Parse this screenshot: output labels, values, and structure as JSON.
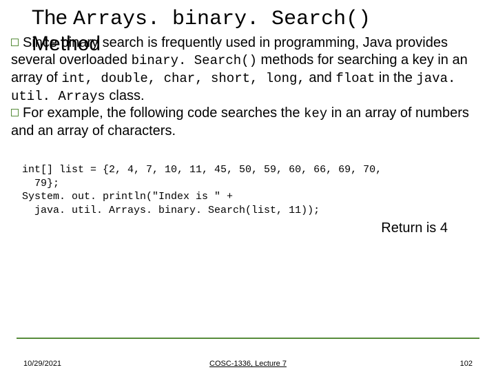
{
  "title": {
    "prefix": "The ",
    "method": "Arrays. binary. Search()",
    "line2": "Method"
  },
  "body": {
    "para1": {
      "lead": "Since binary search is frequently used in programming, Java provides several overloaded ",
      "code1": "binary. Search()",
      "mid1": " methods for searching a key in an array of ",
      "code2": "int, double, char, short, long,",
      "mid2": " and ",
      "code3": "float",
      "mid3": " in the ",
      "code4": "java. util. Arrays",
      "tail": " class."
    },
    "para2": {
      "lead": "For example, the following code searches the ",
      "code1": "key",
      "tail": " in an array of numbers and an array of characters."
    }
  },
  "code": {
    "line1": "int[] list = {2, 4, 7, 10, 11, 45, 50, 59, 60, 66, 69, 70,",
    "line2": "  79};",
    "line3": "System. out. println(\"Index is \" +",
    "line4": "  java. util. Arrays. binary. Search(list, 11));"
  },
  "return_note": "Return is 4",
  "footer": {
    "date": "10/29/2021",
    "course": "COSC-1336, Lecture 7",
    "page": "102"
  }
}
